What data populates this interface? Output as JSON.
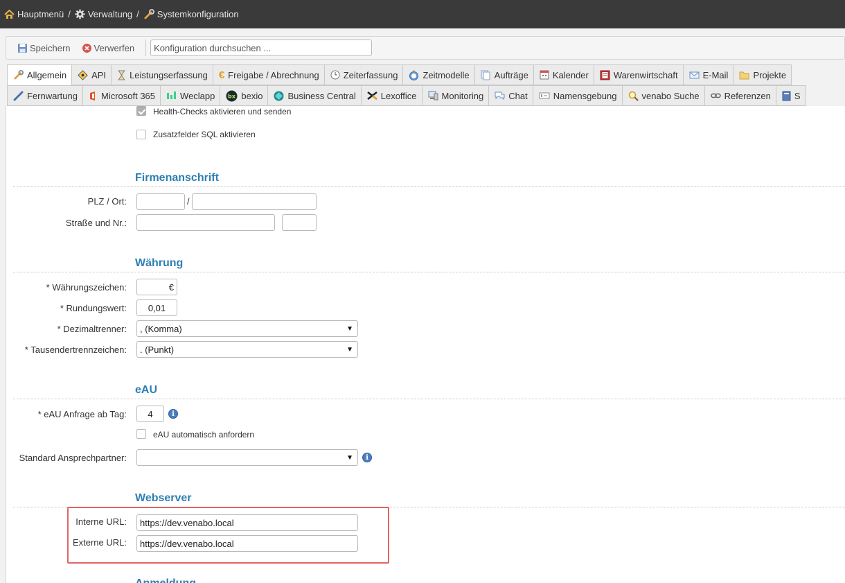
{
  "breadcrumb": [
    {
      "label": "Hauptmenü",
      "icon": "home-icon"
    },
    {
      "label": "Verwaltung",
      "icon": "gear-icon"
    },
    {
      "label": "Systemkonfiguration",
      "icon": "wrench-icon"
    }
  ],
  "breadcrumb_separator": "/",
  "toolbar": {
    "save_label": "Speichern",
    "discard_label": "Verwerfen",
    "search_placeholder": "Konfiguration durchsuchen ..."
  },
  "tabs_row1": [
    {
      "label": "Allgemein",
      "icon": "wrench-icon",
      "active": true
    },
    {
      "label": "API",
      "icon": "api-icon"
    },
    {
      "label": "Leistungserfassung",
      "icon": "hourglass-icon"
    },
    {
      "label": "Freigabe / Abrechnung",
      "icon": "euro-icon"
    },
    {
      "label": "Zeiterfassung",
      "icon": "clock-icon"
    },
    {
      "label": "Zeitmodelle",
      "icon": "stopwatch-icon"
    },
    {
      "label": "Aufträge",
      "icon": "documents-icon"
    },
    {
      "label": "Kalender",
      "icon": "calendar-icon"
    },
    {
      "label": "Warenwirtschaft",
      "icon": "inventory-icon"
    },
    {
      "label": "E-Mail",
      "icon": "mail-icon"
    },
    {
      "label": "Projekte",
      "icon": "folder-icon"
    }
  ],
  "tabs_row2": [
    {
      "label": "Fernwartung",
      "icon": "pen-icon"
    },
    {
      "label": "Microsoft 365",
      "icon": "office-icon"
    },
    {
      "label": "Weclapp",
      "icon": "weclapp-icon"
    },
    {
      "label": "bexio",
      "icon": "bexio-icon"
    },
    {
      "label": "Business Central",
      "icon": "business-central-icon"
    },
    {
      "label": "Lexoffice",
      "icon": "lexoffice-icon"
    },
    {
      "label": "Monitoring",
      "icon": "monitor-icon"
    },
    {
      "label": "Chat",
      "icon": "chat-icon"
    },
    {
      "label": "Namensgebung",
      "icon": "naming-icon"
    },
    {
      "label": "venabo Suche",
      "icon": "search-icon"
    },
    {
      "label": "Referenzen",
      "icon": "link-icon"
    },
    {
      "label": "S",
      "icon": "book-icon"
    }
  ],
  "general": {
    "health_checks_label": "Health-Checks aktivieren und senden",
    "health_checks_checked": true,
    "sql_fields_label": "Zusatzfelder SQL aktivieren",
    "sql_fields_checked": false
  },
  "company_address": {
    "title": "Firmenanschrift",
    "zip_city_label": "PLZ / Ort:",
    "zip_value": "",
    "separator": "/",
    "city_value": "",
    "street_label": "Straße und Nr.:",
    "street_value": "",
    "number_value": ""
  },
  "currency": {
    "title": "Währung",
    "symbol_label": "* Währungszeichen:",
    "symbol_value": "€",
    "rounding_label": "* Rundungswert:",
    "rounding_value": "0,01",
    "decimal_label": "* Dezimaltrenner:",
    "decimal_value": ", (Komma)",
    "thousands_label": "* Tausendertrennzeichen:",
    "thousands_value": ". (Punkt)"
  },
  "eau": {
    "title": "eAU",
    "request_day_label": "* eAU Anfrage ab Tag:",
    "request_day_value": "4",
    "auto_request_label": "eAU automatisch anfordern",
    "auto_request_checked": false,
    "contact_label": "Standard Ansprechpartner:",
    "contact_value": ""
  },
  "webserver": {
    "title": "Webserver",
    "internal_label": "Interne URL:",
    "internal_value": "https://dev.venabo.local",
    "external_label": "Externe URL:",
    "external_value": "https://dev.venabo.local"
  },
  "next_section_title": "Anmeldung",
  "colors": {
    "accent": "#2e7fb3",
    "topbar": "#3a3a3a",
    "highlight": "#e06666"
  }
}
